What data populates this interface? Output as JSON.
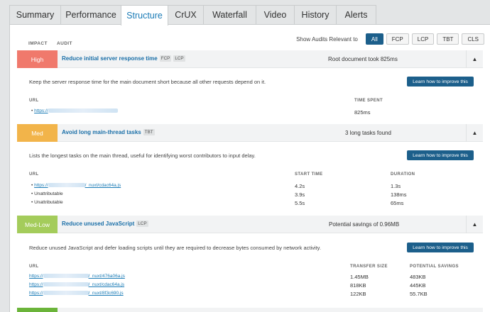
{
  "tabs": [
    {
      "label": "Summary",
      "active": false
    },
    {
      "label": "Performance",
      "active": false
    },
    {
      "label": "Structure",
      "active": true
    },
    {
      "label": "CrUX",
      "active": false
    },
    {
      "label": "Waterfall",
      "active": false
    },
    {
      "label": "Video",
      "active": false
    },
    {
      "label": "History",
      "active": false
    },
    {
      "label": "Alerts",
      "active": false
    }
  ],
  "columns": {
    "impact": "IMPACT",
    "audit": "AUDIT"
  },
  "filter": {
    "label": "Show Audits Relevant to",
    "options": [
      "All",
      "FCP",
      "LCP",
      "TBT",
      "CLS"
    ],
    "selected": "All"
  },
  "audits": [
    {
      "impact": "High",
      "impact_color": "#f0796c",
      "title": "Reduce initial server response time",
      "tags": [
        "FCP",
        "LCP"
      ],
      "summary": "Root document took 825ms",
      "toggle": "▲",
      "description": "Keep the server response time for the main document short because all other requests depend on it.",
      "button": "Learn how to improve this",
      "headers": [
        "URL",
        "TIME SPENT"
      ],
      "rows": [
        {
          "url": "https://",
          "time": "825ms"
        }
      ]
    },
    {
      "impact": "Med",
      "impact_color": "#f2b44a",
      "title": "Avoid long main-thread tasks",
      "tags": [
        "TBT"
      ],
      "summary": "3 long tasks found",
      "toggle": "▲",
      "description": "Lists the longest tasks on the main thread, useful for identifying worst contributors to input delay.",
      "button": "Learn how to improve this",
      "headers": [
        "URL",
        "START TIME",
        "DURATION"
      ],
      "rows": [
        {
          "url": "https://",
          "url_suffix": "/_nuxt/cdac64a.js",
          "start": "4.2s",
          "duration": "1.3s"
        },
        {
          "url": "Unattributable",
          "start": "3.9s",
          "duration": "138ms"
        },
        {
          "url": "Unattributable",
          "start": "5.5s",
          "duration": "65ms"
        }
      ]
    },
    {
      "impact": "Med-Low",
      "impact_color": "#a4cc5b",
      "title": "Reduce unused JavaScript",
      "tags": [
        "LCP"
      ],
      "summary": "Potential savings of 0.96MB",
      "toggle": "▲",
      "description": "Reduce unused JavaScript and defer loading scripts until they are required to decrease bytes consumed by network activity.",
      "button": "Learn how to improve this",
      "headers": [
        "URL",
        "TRANSFER SIZE",
        "POTENTIAL SAVINGS"
      ],
      "rows": [
        {
          "url": "https://",
          "url_suffix": "/_nuxt/476a06a.js",
          "size": "1.45MB",
          "savings": "483KB"
        },
        {
          "url": "https://",
          "url_suffix": "/_nuxt/cdac64a.js",
          "size": "818KB",
          "savings": "445KB"
        },
        {
          "url": "https://",
          "url_suffix": "/_nuxt/8f3c690.js",
          "size": "122KB",
          "savings": "55.7KB"
        }
      ]
    }
  ]
}
